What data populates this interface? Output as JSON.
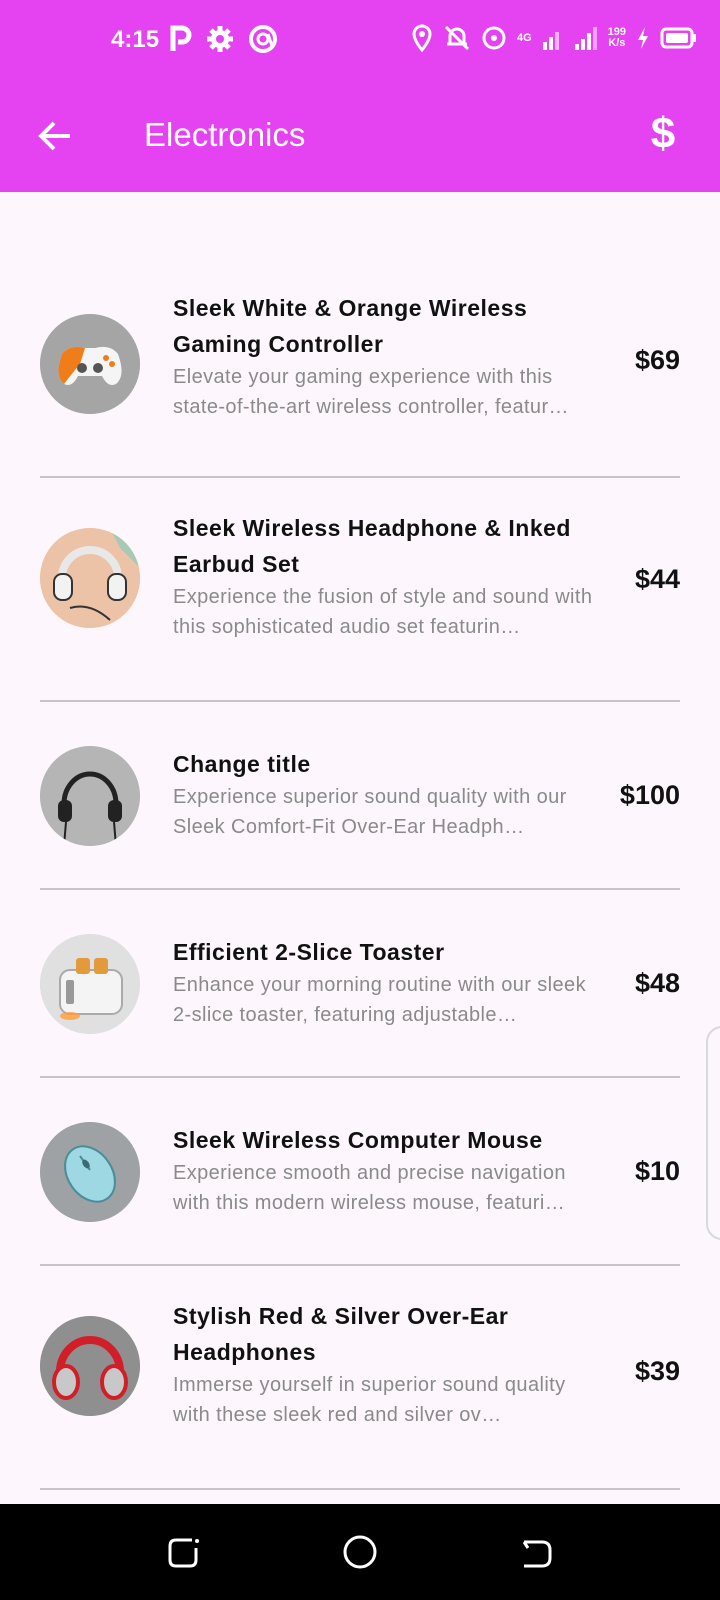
{
  "status_bar": {
    "time": "4:15",
    "net_speed_value": "199",
    "net_speed_unit": "K/s",
    "network_label": "4G",
    "icons": [
      "parking-icon",
      "gear-icon",
      "at-sign-icon",
      "location-icon",
      "bell-off-icon",
      "hotspot-icon",
      "signal-icon",
      "signal-icon",
      "bolt-icon",
      "battery-icon"
    ]
  },
  "app_bar": {
    "title": "Electronics",
    "currency_symbol": "$",
    "background_color": "#e542f2"
  },
  "products": [
    {
      "name": "Sleek White & Orange Wireless Gaming Controller",
      "description": "Elevate your gaming experience with this state-of-the-art wireless controller, featur…",
      "price": "$69",
      "image_icon": "game-controller-icon"
    },
    {
      "name": "Sleek Wireless Headphone & Inked Earbud Set",
      "description": "Experience the fusion of style and sound with this sophisticated audio set featurin…",
      "price": "$44",
      "image_icon": "headphones-icon"
    },
    {
      "name": "Change title",
      "description": "Experience superior sound quality with our Sleek Comfort-Fit Over-Ear Headph…",
      "price": "$100",
      "image_icon": "headphones-icon"
    },
    {
      "name": "Efficient 2-Slice Toaster",
      "description": "Enhance your morning routine with our sleek 2-slice toaster, featuring adjustable…",
      "price": "$48",
      "image_icon": "toaster-icon"
    },
    {
      "name": "Sleek Wireless Computer Mouse",
      "description": "Experience smooth and precise navigation with this modern wireless mouse, featuri…",
      "price": "$10",
      "image_icon": "mouse-icon"
    },
    {
      "name": "Stylish Red & Silver Over-Ear Headphones",
      "description": "Immerse yourself in superior sound quality with these sleek red and silver ov…",
      "price": "$39",
      "image_icon": "headphones-icon"
    }
  ],
  "nav_bar": {
    "icons": [
      "recent-apps-icon",
      "home-icon",
      "back-nav-icon"
    ]
  }
}
